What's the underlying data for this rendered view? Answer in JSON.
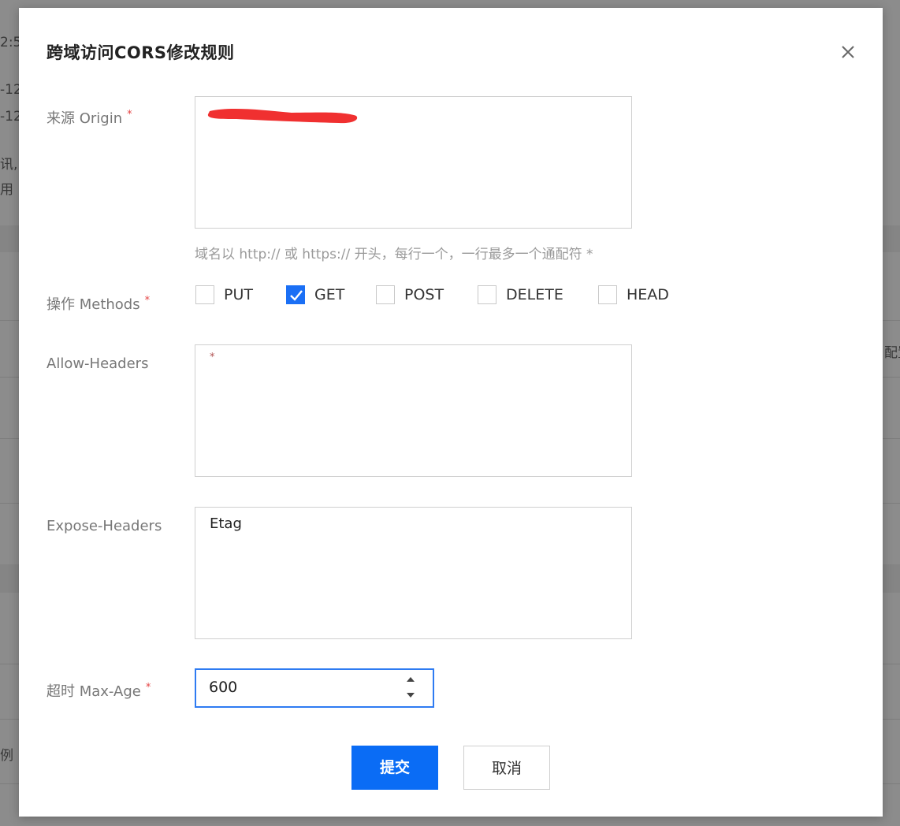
{
  "background": {
    "fragments": [
      "2:5",
      "-12",
      "-12",
      "讯,",
      "用",
      "配置",
      "例"
    ]
  },
  "dialog": {
    "title": "跨域访问CORS修改规则",
    "close_icon": "close-icon"
  },
  "origin": {
    "label": "来源 Origin",
    "required_mark": "*",
    "value_redacted": true,
    "hint": "域名以 http:// 或 https:// 开头，每行一个，一行最多一个通配符 *"
  },
  "methods": {
    "label": "操作 Methods",
    "required_mark": "*",
    "options": [
      {
        "label": "PUT",
        "checked": false
      },
      {
        "label": "GET",
        "checked": true
      },
      {
        "label": "POST",
        "checked": false
      },
      {
        "label": "DELETE",
        "checked": false
      },
      {
        "label": "HEAD",
        "checked": false
      }
    ]
  },
  "allow_headers": {
    "label": "Allow-Headers",
    "value": "*"
  },
  "expose_headers": {
    "label": "Expose-Headers",
    "value": "Etag"
  },
  "max_age": {
    "label": "超时 Max-Age",
    "required_mark": "*",
    "value": "600"
  },
  "buttons": {
    "submit": "提交",
    "cancel": "取消"
  },
  "colors": {
    "primary": "#0a6cf5",
    "required": "#e54545",
    "redaction": "#f03030"
  }
}
